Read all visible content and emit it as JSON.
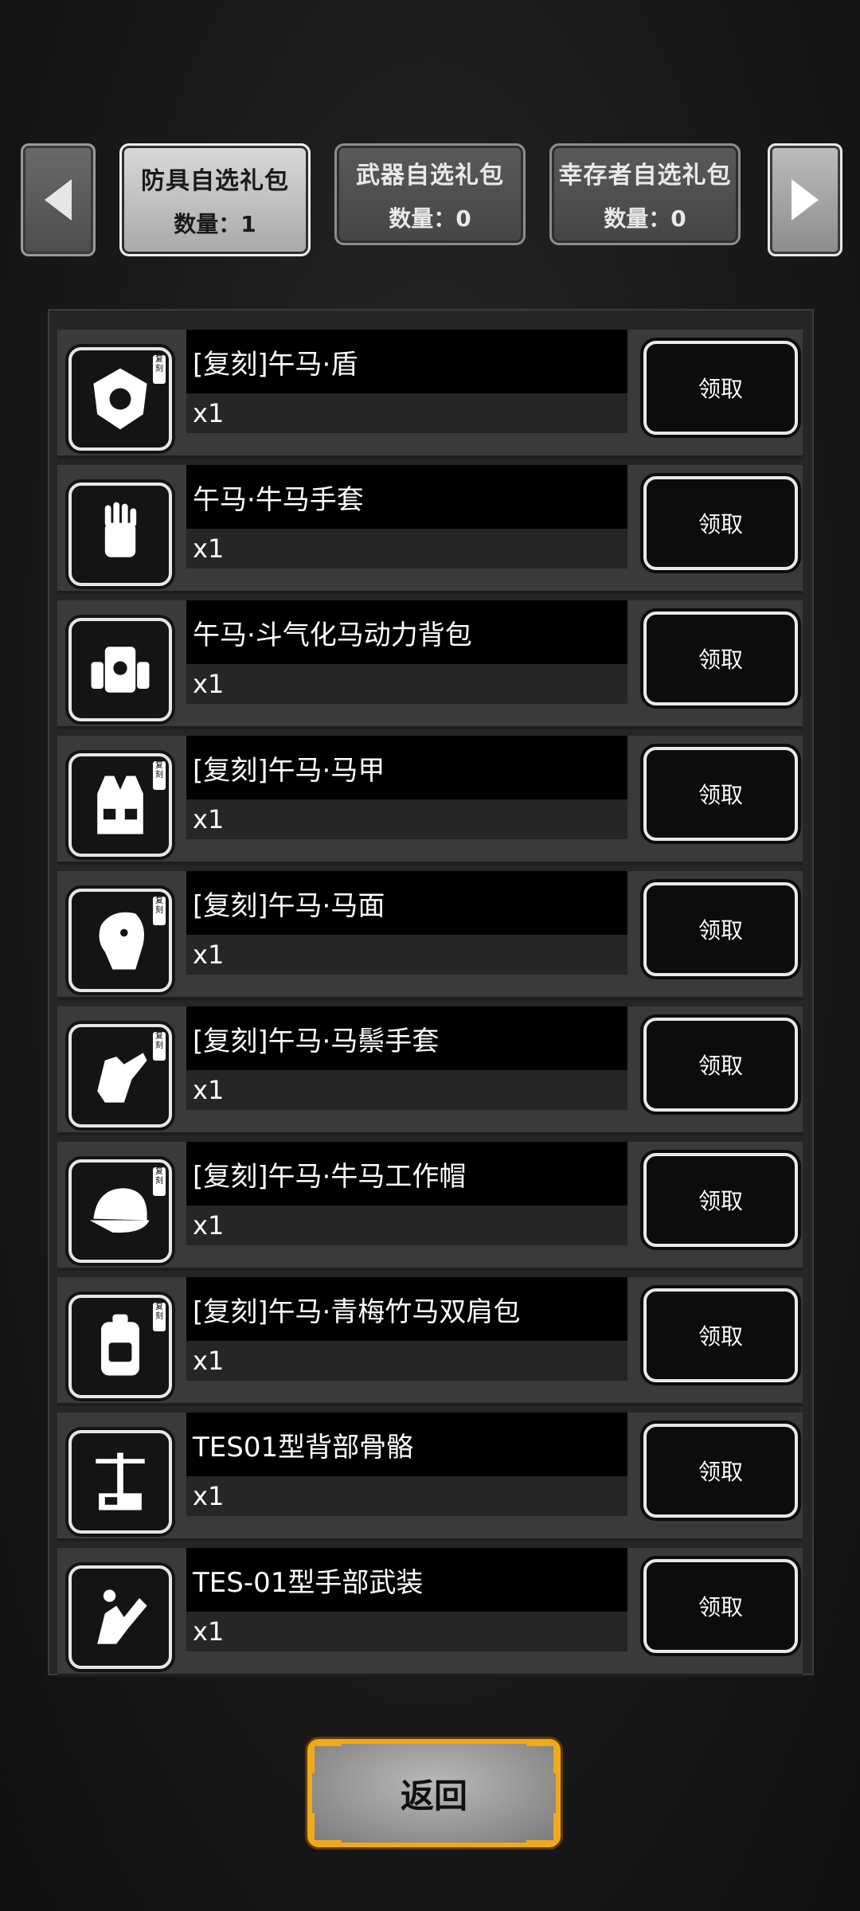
{
  "tabs": [
    {
      "title": "防具自选礼包",
      "count": "数量：1",
      "active": true
    },
    {
      "title": "武器自选礼包",
      "count": "数量：0",
      "active": false
    },
    {
      "title": "幸存者自选礼包",
      "count": "数量：0",
      "active": false
    }
  ],
  "items": [
    {
      "name": "[复刻]午马·盾",
      "qty": "x1",
      "claim": "领取",
      "icon": "shield-icon",
      "tag": "复刻"
    },
    {
      "name": "午马·牛马手套",
      "qty": "x1",
      "claim": "领取",
      "icon": "glove-icon",
      "tag": ""
    },
    {
      "name": "午马·斗气化马动力背包",
      "qty": "x1",
      "claim": "领取",
      "icon": "power-backpack-icon",
      "tag": ""
    },
    {
      "name": "[复刻]午马·马甲",
      "qty": "x1",
      "claim": "领取",
      "icon": "vest-icon",
      "tag": "复刻"
    },
    {
      "name": "[复刻]午马·马面",
      "qty": "x1",
      "claim": "领取",
      "icon": "horse-mask-icon",
      "tag": "复刻"
    },
    {
      "name": "[复刻]午马·马鬃手套",
      "qty": "x1",
      "claim": "领取",
      "icon": "glove-icon",
      "tag": "复刻"
    },
    {
      "name": "[复刻]午马·牛马工作帽",
      "qty": "x1",
      "claim": "领取",
      "icon": "work-cap-icon",
      "tag": "复刻"
    },
    {
      "name": "[复刻]午马·青梅竹马双肩包",
      "qty": "x1",
      "claim": "领取",
      "icon": "backpack-icon",
      "tag": "复刻"
    },
    {
      "name": "TES01型背部骨骼",
      "qty": "x1",
      "claim": "领取",
      "icon": "exoskeleton-icon",
      "tag": ""
    },
    {
      "name": "TES-01型手部武装",
      "qty": "x1",
      "claim": "领取",
      "icon": "arm-weapon-icon",
      "tag": ""
    }
  ],
  "back_label": "返回",
  "colors": {
    "accent": "#f0a91c",
    "panel": "#262626",
    "row": "#3a3a3a"
  }
}
